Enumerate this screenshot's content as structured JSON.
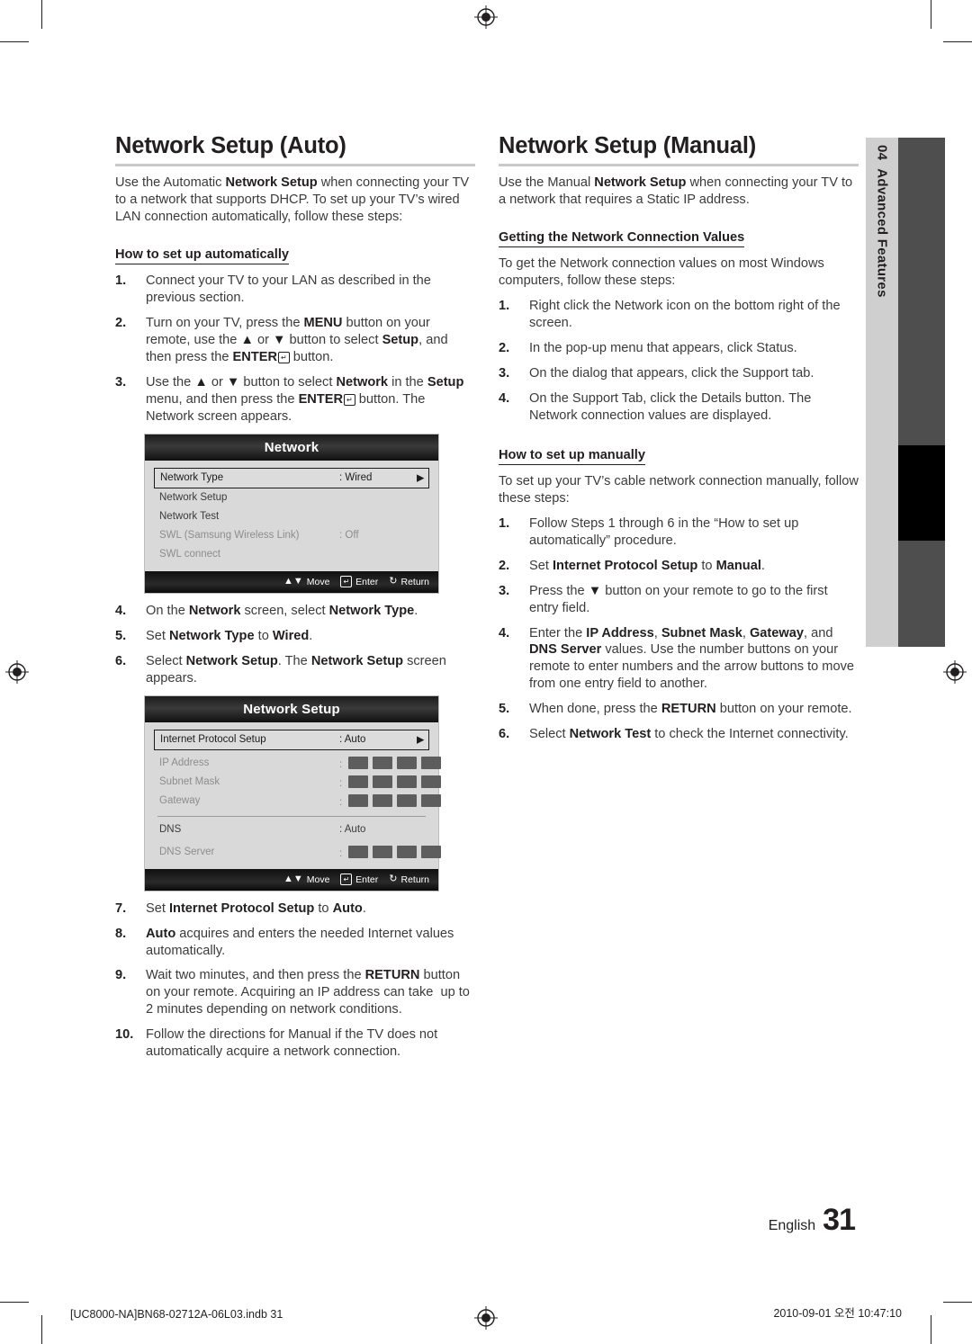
{
  "document": {
    "page_number": "31",
    "language_label": "English",
    "chapter_number": "04",
    "chapter_title": "Advanced Features",
    "footer_left": "[UC8000-NA]BN68-02712A-06L03.indb   31",
    "footer_right": "2010-09-01   오전 10:47:10"
  },
  "left_column": {
    "title": "Network Setup (Auto)",
    "intro": "Use the Automatic Network Setup when connecting your TV to a network that supports DHCP. To set up your TV’s wired LAN connection automatically, follow these steps:",
    "subhead": "How to set up automatically",
    "steps_1_3": [
      {
        "num": "1.",
        "text": "Connect your TV to your LAN as described in the previous section."
      },
      {
        "num": "2.",
        "text": "Turn on your TV, press the MENU button on your remote, use the ▲ or ▼ button to select Setup, and then press the ENTER button."
      },
      {
        "num": "3.",
        "text": "Use the ▲ or ▼ button to select Network in the Setup menu, and then press the ENTER button. The Network screen appears."
      }
    ],
    "steps_4_6": [
      {
        "num": "4.",
        "text": "On the Network screen, select Network Type."
      },
      {
        "num": "5.",
        "text": "Set Network Type to Wired."
      },
      {
        "num": "6.",
        "text": "Select Network Setup. The Network Setup screen appears."
      }
    ],
    "steps_7_10": [
      {
        "num": "7.",
        "text": "Set Internet Protocol Setup to Auto."
      },
      {
        "num": "8.",
        "text": "Auto acquires and enters the needed Internet values automatically."
      },
      {
        "num": "9.",
        "text": "Wait two minutes, and then press the RETURN button on your remote. Acquiring an IP address can take  up to 2 minutes depending on network conditions."
      },
      {
        "num": "10.",
        "text": "Follow the directions for Manual if the TV does not automatically acquire a network connection."
      }
    ]
  },
  "right_column": {
    "title": "Network Setup (Manual)",
    "intro": "Use the Manual Network Setup when connecting your TV to a network that requires a Static IP address.",
    "subhead_1": "Getting the Network Connection Values",
    "intro_2": "To get the Network connection values on most Windows computers, follow these steps:",
    "steps_values": [
      {
        "num": "1.",
        "text": "Right click the Network icon on the bottom right of the screen."
      },
      {
        "num": "2.",
        "text": "In the pop-up menu that appears, click Status."
      },
      {
        "num": "3.",
        "text": "On the dialog that appears, click the Support tab."
      },
      {
        "num": "4.",
        "text": "On the Support Tab, click the Details button. The Network connection values are displayed."
      }
    ],
    "subhead_2": "How to set up manually",
    "intro_3": "To set up your TV’s cable network connection manually, follow these steps:",
    "steps_manual": [
      {
        "num": "1.",
        "text": "Follow Steps 1 through 6 in the “How to set up automatically” procedure."
      },
      {
        "num": "2.",
        "text": "Set Internet Protocol Setup to Manual."
      },
      {
        "num": "3.",
        "text": "Press the ▼ button on your remote to go to the first entry field."
      },
      {
        "num": "4.",
        "text": "Enter the IP Address, Subnet Mask, Gateway, and DNS Server values. Use the number buttons on your remote to enter numbers and the arrow buttons to move from one entry field to another."
      },
      {
        "num": "5.",
        "text": "When done, press the RETURN button on your remote."
      },
      {
        "num": "6.",
        "text": "Select Network Test to check the Internet connectivity."
      }
    ]
  },
  "osd_network": {
    "title": "Network",
    "rows": [
      {
        "label": "Network Type",
        "value": ": Wired",
        "selected": true,
        "arrow": "▶"
      },
      {
        "label": "Network Setup",
        "value": "",
        "selected": false
      },
      {
        "label": "Network Test",
        "value": "",
        "selected": false
      },
      {
        "label": "SWL (Samsung Wireless Link)",
        "value": ": Off",
        "dim": true
      },
      {
        "label": "SWL connect",
        "value": "",
        "dim": true
      }
    ],
    "footer": {
      "move": "Move",
      "enter": "Enter",
      "return": "Return"
    }
  },
  "osd_network_setup": {
    "title": "Network Setup",
    "rows": [
      {
        "label": "Internet Protocol Setup",
        "value": ": Auto",
        "selected": true,
        "arrow": "▶"
      },
      {
        "label": "IP Address",
        "value": ":",
        "dim": true,
        "blocks": 4
      },
      {
        "label": "Subnet Mask",
        "value": ":",
        "dim": true,
        "blocks": 4
      },
      {
        "label": "Gateway",
        "value": ":",
        "dim": true,
        "blocks": 4
      },
      {
        "label": "DNS",
        "value": ": Auto",
        "dim": false
      },
      {
        "label": "DNS Server",
        "value": ":",
        "dim": true,
        "blocks": 4
      }
    ],
    "footer": {
      "move": "Move",
      "enter": "Enter",
      "return": "Return"
    }
  },
  "colors": {
    "text": "#231f20",
    "body_text": "#3b3b3b",
    "rule": "#c9c9c9",
    "tab_band": "#cfcfcf",
    "tab_bar": "#4e4e4e",
    "tab_active": "#000000",
    "osd_bg": "#d9d9d9"
  }
}
